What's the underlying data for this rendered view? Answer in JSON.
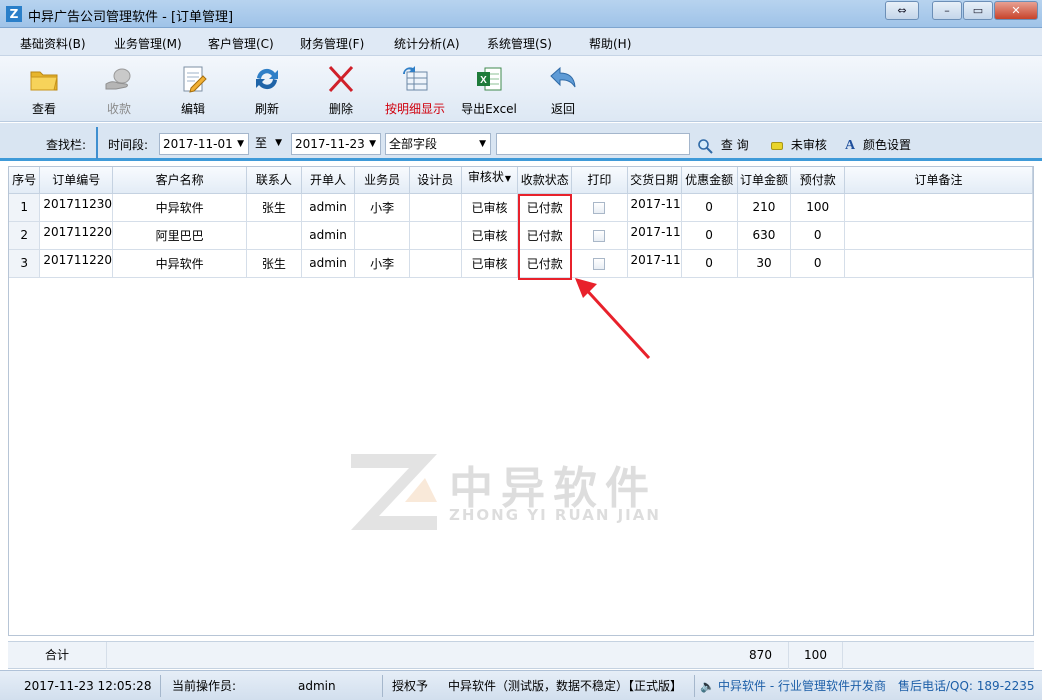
{
  "window": {
    "title": "中异广告公司管理软件 - [订单管理]",
    "icon_letter": "Z"
  },
  "menu": [
    "基础资料(B)",
    "业务管理(M)",
    "客户管理(C)",
    "财务管理(F)",
    "统计分析(A)",
    "系统管理(S)",
    "帮助(H)"
  ],
  "toolbar": {
    "view": "查看",
    "collect": "收款",
    "edit": "编辑",
    "refresh": "刷新",
    "delete": "删除",
    "detail": "按明细显示",
    "export": "导出Excel",
    "back": "返回"
  },
  "search": {
    "label": "查找栏:",
    "period_label": "时间段:",
    "date_from": "2017-11-01",
    "to_label": "至",
    "date_to": "2017-11-23",
    "field": "全部字段",
    "query_button": "查 询",
    "unaudited_button": "未审核",
    "color_button": "颜色设置"
  },
  "table": {
    "headers": [
      "序号",
      "订单编号",
      "客户名称",
      "联系人",
      "开单人",
      "业务员",
      "设计员",
      "审核状",
      "收款状态",
      "打印",
      "交货日期",
      "优惠金额",
      "订单金额",
      "预付款",
      "订单备注"
    ],
    "rows": [
      {
        "no": "1",
        "order_no": "201711230",
        "customer": "中异软件",
        "contact": "张生",
        "creator": "admin",
        "sales": "小李",
        "designer": "",
        "audit": "已审核",
        "payment": "已付款",
        "delivery": "2017-11",
        "discount": "0",
        "amount": "210",
        "prepaid": "100",
        "remark": ""
      },
      {
        "no": "2",
        "order_no": "201711220",
        "customer": "阿里巴巴",
        "contact": "",
        "creator": "admin",
        "sales": "",
        "designer": "",
        "audit": "已审核",
        "payment": "已付款",
        "delivery": "2017-11",
        "discount": "0",
        "amount": "630",
        "prepaid": "0",
        "remark": ""
      },
      {
        "no": "3",
        "order_no": "201711220",
        "customer": "中异软件",
        "contact": "张生",
        "creator": "admin",
        "sales": "小李",
        "designer": "",
        "audit": "已审核",
        "payment": "已付款",
        "delivery": "2017-11",
        "discount": "0",
        "amount": "30",
        "prepaid": "0",
        "remark": ""
      }
    ]
  },
  "watermark": {
    "cn": "中异软件",
    "en": "ZHONG YI RUAN JIAN"
  },
  "summary": {
    "label": "合计",
    "amount_total": "870",
    "prepaid_total": "100"
  },
  "status": {
    "datetime": "2017-11-23 12:05:28",
    "operator_label": "当前操作员:",
    "operator": "admin",
    "license_label": "授权予",
    "license_text": "中异软件（测试版，数据不稳定）【正式版】",
    "vendor": "中异软件 - 行业管理软件开发商",
    "support": "售后电话/QQ: 189-2235"
  },
  "colors": {
    "accent": "#3f9ad8",
    "highlight": "#e8212b",
    "delete_red": "#d0000d"
  }
}
